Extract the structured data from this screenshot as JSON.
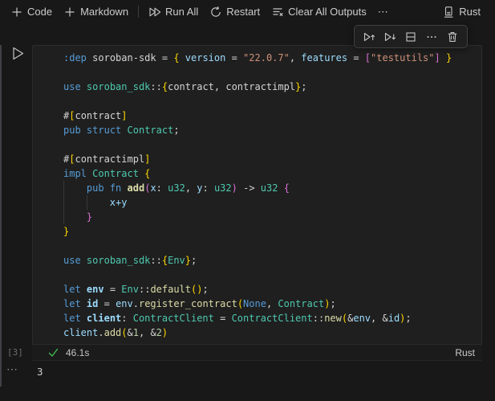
{
  "notebook_toolbar": {
    "items": [
      {
        "label": "Code",
        "icon": "plus-icon"
      },
      {
        "label": "Markdown",
        "icon": "plus-icon"
      },
      {
        "label": "Run All",
        "icon": "run-all-icon"
      },
      {
        "label": "Restart",
        "icon": "restart-icon"
      },
      {
        "label": "Clear All Outputs",
        "icon": "clear-all-outputs-icon"
      },
      {
        "label": "⋯",
        "icon": "more-actions-icon"
      }
    ],
    "kernel": {
      "label": "Rust",
      "icon": "kernel-icon"
    }
  },
  "cell_toolbar": {
    "icons": [
      "execute-above-icon",
      "execute-below-icon",
      "split-cell-icon",
      "more-icon",
      "delete-icon"
    ]
  },
  "cell": {
    "run_icon": "run-cell-icon",
    "execution_count": "[3]",
    "status": {
      "success_icon": "check-icon",
      "duration": "46.1s",
      "language": "Rust"
    },
    "output": {
      "more": "⋯",
      "value": "3"
    }
  },
  "colors": {
    "keyword": "#569CD6",
    "type": "#4EC9B0",
    "function": "#DCDCAA",
    "variable": "#9CDCFE",
    "string": "#CE9178",
    "number": "#B5CEA8",
    "text": "#D4D4D4",
    "bracket_level1": "#FFD700",
    "bracket_level2": "#DA70D6",
    "check_green": "#3FB950",
    "editor_bg": "#1F1F1F",
    "page_bg": "#181818"
  },
  "code": {
    "lines": [
      [
        {
          "t": ":dep",
          "s": "kw"
        },
        {
          "t": " ",
          "s": "pu"
        },
        {
          "t": "soroban-sdk",
          "s": "tx"
        },
        {
          "t": " = ",
          "s": "pu"
        },
        {
          "t": "{",
          "s": "b1"
        },
        {
          "t": " ",
          "s": "pu"
        },
        {
          "t": "version",
          "s": "va"
        },
        {
          "t": " = ",
          "s": "pu"
        },
        {
          "t": "\"22.0.7\"",
          "s": "st"
        },
        {
          "t": ", ",
          "s": "pu"
        },
        {
          "t": "features",
          "s": "va"
        },
        {
          "t": " = ",
          "s": "pu"
        },
        {
          "t": "[",
          "s": "b2"
        },
        {
          "t": "\"testutils\"",
          "s": "st"
        },
        {
          "t": "]",
          "s": "b2"
        },
        {
          "t": " ",
          "s": "pu"
        },
        {
          "t": "}",
          "s": "b1"
        }
      ],
      [],
      [
        {
          "t": "use",
          "s": "kw"
        },
        {
          "t": " ",
          "s": "pu"
        },
        {
          "t": "soroban_sdk",
          "s": "ty"
        },
        {
          "t": "::",
          "s": "pu"
        },
        {
          "t": "{",
          "s": "b1"
        },
        {
          "t": "contract, contractimpl",
          "s": "tx"
        },
        {
          "t": "}",
          "s": "b1"
        },
        {
          "t": ";",
          "s": "pu"
        }
      ],
      [],
      [
        {
          "t": "#",
          "s": "pu"
        },
        {
          "t": "[",
          "s": "b1"
        },
        {
          "t": "contract",
          "s": "tx"
        },
        {
          "t": "]",
          "s": "b1"
        }
      ],
      [
        {
          "t": "pub",
          "s": "kw"
        },
        {
          "t": " ",
          "s": "pu"
        },
        {
          "t": "struct",
          "s": "kw"
        },
        {
          "t": " ",
          "s": "pu"
        },
        {
          "t": "Contract",
          "s": "ty"
        },
        {
          "t": ";",
          "s": "pu"
        }
      ],
      [],
      [
        {
          "t": "#",
          "s": "pu"
        },
        {
          "t": "[",
          "s": "b1"
        },
        {
          "t": "contractimpl",
          "s": "tx"
        },
        {
          "t": "]",
          "s": "b1"
        }
      ],
      [
        {
          "t": "impl",
          "s": "kw"
        },
        {
          "t": " ",
          "s": "pu"
        },
        {
          "t": "Contract",
          "s": "ty"
        },
        {
          "t": " ",
          "s": "pu"
        },
        {
          "t": "{",
          "s": "b1"
        }
      ],
      [
        {
          "t": "    ",
          "s": "pu"
        },
        {
          "t": "pub",
          "s": "kw"
        },
        {
          "t": " ",
          "s": "pu"
        },
        {
          "t": "fn",
          "s": "kw"
        },
        {
          "t": " ",
          "s": "pu"
        },
        {
          "t": "add",
          "s": "fnb"
        },
        {
          "t": "(",
          "s": "b2"
        },
        {
          "t": "x",
          "s": "va"
        },
        {
          "t": ": ",
          "s": "pu"
        },
        {
          "t": "u32",
          "s": "ty"
        },
        {
          "t": ", ",
          "s": "pu"
        },
        {
          "t": "y",
          "s": "va"
        },
        {
          "t": ": ",
          "s": "pu"
        },
        {
          "t": "u32",
          "s": "ty"
        },
        {
          "t": ")",
          "s": "b2"
        },
        {
          "t": " -> ",
          "s": "pu"
        },
        {
          "t": "u32",
          "s": "ty"
        },
        {
          "t": " ",
          "s": "pu"
        },
        {
          "t": "{",
          "s": "b2"
        }
      ],
      [
        {
          "t": "        ",
          "s": "pu"
        },
        {
          "t": "x+y",
          "s": "va"
        }
      ],
      [
        {
          "t": "    ",
          "s": "pu"
        },
        {
          "t": "}",
          "s": "b2"
        }
      ],
      [
        {
          "t": "}",
          "s": "b1"
        }
      ],
      [],
      [
        {
          "t": "use",
          "s": "kw"
        },
        {
          "t": " ",
          "s": "pu"
        },
        {
          "t": "soroban_sdk",
          "s": "ty"
        },
        {
          "t": "::",
          "s": "pu"
        },
        {
          "t": "{",
          "s": "b1"
        },
        {
          "t": "Env",
          "s": "ty"
        },
        {
          "t": "}",
          "s": "b1"
        },
        {
          "t": ";",
          "s": "pu"
        }
      ],
      [],
      [
        {
          "t": "let",
          "s": "kw"
        },
        {
          "t": " ",
          "s": "pu"
        },
        {
          "t": "env",
          "s": "vb"
        },
        {
          "t": " = ",
          "s": "pu"
        },
        {
          "t": "Env",
          "s": "ty"
        },
        {
          "t": "::",
          "s": "pu"
        },
        {
          "t": "default",
          "s": "fn"
        },
        {
          "t": "(",
          "s": "b1"
        },
        {
          "t": ")",
          "s": "b1"
        },
        {
          "t": ";",
          "s": "pu"
        }
      ],
      [
        {
          "t": "let",
          "s": "kw"
        },
        {
          "t": " ",
          "s": "pu"
        },
        {
          "t": "id",
          "s": "vb"
        },
        {
          "t": " = ",
          "s": "pu"
        },
        {
          "t": "env",
          "s": "va"
        },
        {
          "t": ".",
          "s": "pu"
        },
        {
          "t": "register_contract",
          "s": "fn"
        },
        {
          "t": "(",
          "s": "b1"
        },
        {
          "t": "None",
          "s": "kw"
        },
        {
          "t": ", ",
          "s": "pu"
        },
        {
          "t": "Contract",
          "s": "ty"
        },
        {
          "t": ")",
          "s": "b1"
        },
        {
          "t": ";",
          "s": "pu"
        }
      ],
      [
        {
          "t": "let",
          "s": "kw"
        },
        {
          "t": " ",
          "s": "pu"
        },
        {
          "t": "client",
          "s": "vb"
        },
        {
          "t": ": ",
          "s": "pu"
        },
        {
          "t": "ContractClient",
          "s": "ty"
        },
        {
          "t": " = ",
          "s": "pu"
        },
        {
          "t": "ContractClient",
          "s": "ty"
        },
        {
          "t": "::",
          "s": "pu"
        },
        {
          "t": "new",
          "s": "fn"
        },
        {
          "t": "(",
          "s": "b1"
        },
        {
          "t": "&",
          "s": "pu"
        },
        {
          "t": "env",
          "s": "va"
        },
        {
          "t": ", ",
          "s": "pu"
        },
        {
          "t": "&",
          "s": "pu"
        },
        {
          "t": "id",
          "s": "va"
        },
        {
          "t": ")",
          "s": "b1"
        },
        {
          "t": ";",
          "s": "pu"
        }
      ],
      [
        {
          "t": "client",
          "s": "va"
        },
        {
          "t": ".",
          "s": "pu"
        },
        {
          "t": "add",
          "s": "fn"
        },
        {
          "t": "(",
          "s": "b1"
        },
        {
          "t": "&",
          "s": "pu"
        },
        {
          "t": "1",
          "s": "nu"
        },
        {
          "t": ", ",
          "s": "pu"
        },
        {
          "t": "&",
          "s": "pu"
        },
        {
          "t": "2",
          "s": "nu"
        },
        {
          "t": ")",
          "s": "b1"
        }
      ]
    ]
  }
}
